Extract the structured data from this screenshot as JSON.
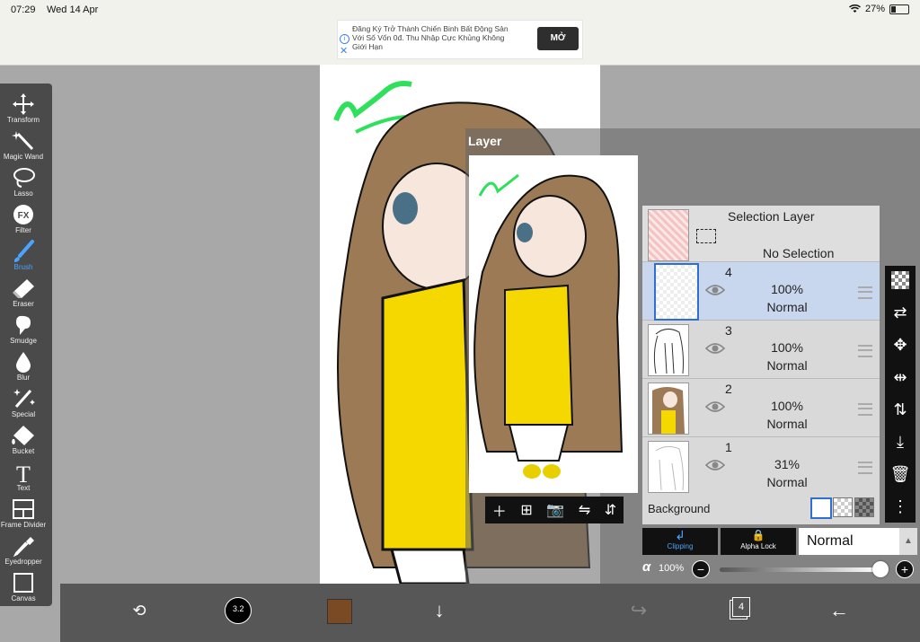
{
  "status": {
    "time": "07:29",
    "date": "Wed 14 Apr",
    "battery": "27%"
  },
  "ad": {
    "text": "Đăng Ký Trở Thành Chiến Binh Bất Động Sản Với Số Vốn 0đ. Thu Nhập Cực Khủng Không Giới Hạn",
    "cta": "MỞ"
  },
  "tools": [
    {
      "label": "Transform",
      "icon": "transform-icon"
    },
    {
      "label": "Magic Wand",
      "icon": "magic-wand-icon"
    },
    {
      "label": "Lasso",
      "icon": "lasso-icon"
    },
    {
      "label": "Filter",
      "icon": "fx-icon",
      "glyph": "FX"
    },
    {
      "label": "Brush",
      "icon": "brush-icon",
      "active": true
    },
    {
      "label": "Eraser",
      "icon": "eraser-icon"
    },
    {
      "label": "Smudge",
      "icon": "smudge-icon"
    },
    {
      "label": "Blur",
      "icon": "blur-icon"
    },
    {
      "label": "Special",
      "icon": "special-icon"
    },
    {
      "label": "Bucket",
      "icon": "bucket-icon"
    },
    {
      "label": "Text",
      "icon": "text-icon",
      "glyph": "T"
    },
    {
      "label": "Frame Divider",
      "icon": "frame-divider-icon"
    },
    {
      "label": "Eyedropper",
      "icon": "eyedropper-icon"
    },
    {
      "label": "Canvas",
      "icon": "canvas-icon"
    }
  ],
  "layer_panel": {
    "title": "Layer",
    "selection_layer": {
      "title": "Selection Layer",
      "status": "No Selection"
    },
    "layers": [
      {
        "number": "4",
        "opacity": "100%",
        "blend": "Normal",
        "selected": true
      },
      {
        "number": "3",
        "opacity": "100%",
        "blend": "Normal"
      },
      {
        "number": "2",
        "opacity": "100%",
        "blend": "Normal"
      },
      {
        "number": "1",
        "opacity": "31%",
        "blend": "Normal"
      }
    ],
    "background_label": "Background",
    "clipping_label": "Clipping",
    "alpha_lock_label": "Alpha Lock",
    "blend_mode": "Normal",
    "alpha_symbol": "α",
    "alpha_value": "100%"
  },
  "bottom": {
    "brush_size": "3.2",
    "layer_count": "4",
    "color": "#7a4a24"
  },
  "colors": {
    "accent": "#4aa3ff",
    "toolbar": "#4a4a4a",
    "selected_row": "#c8d6ee",
    "hair": "#9b7a55",
    "dress": "#f5d800"
  }
}
